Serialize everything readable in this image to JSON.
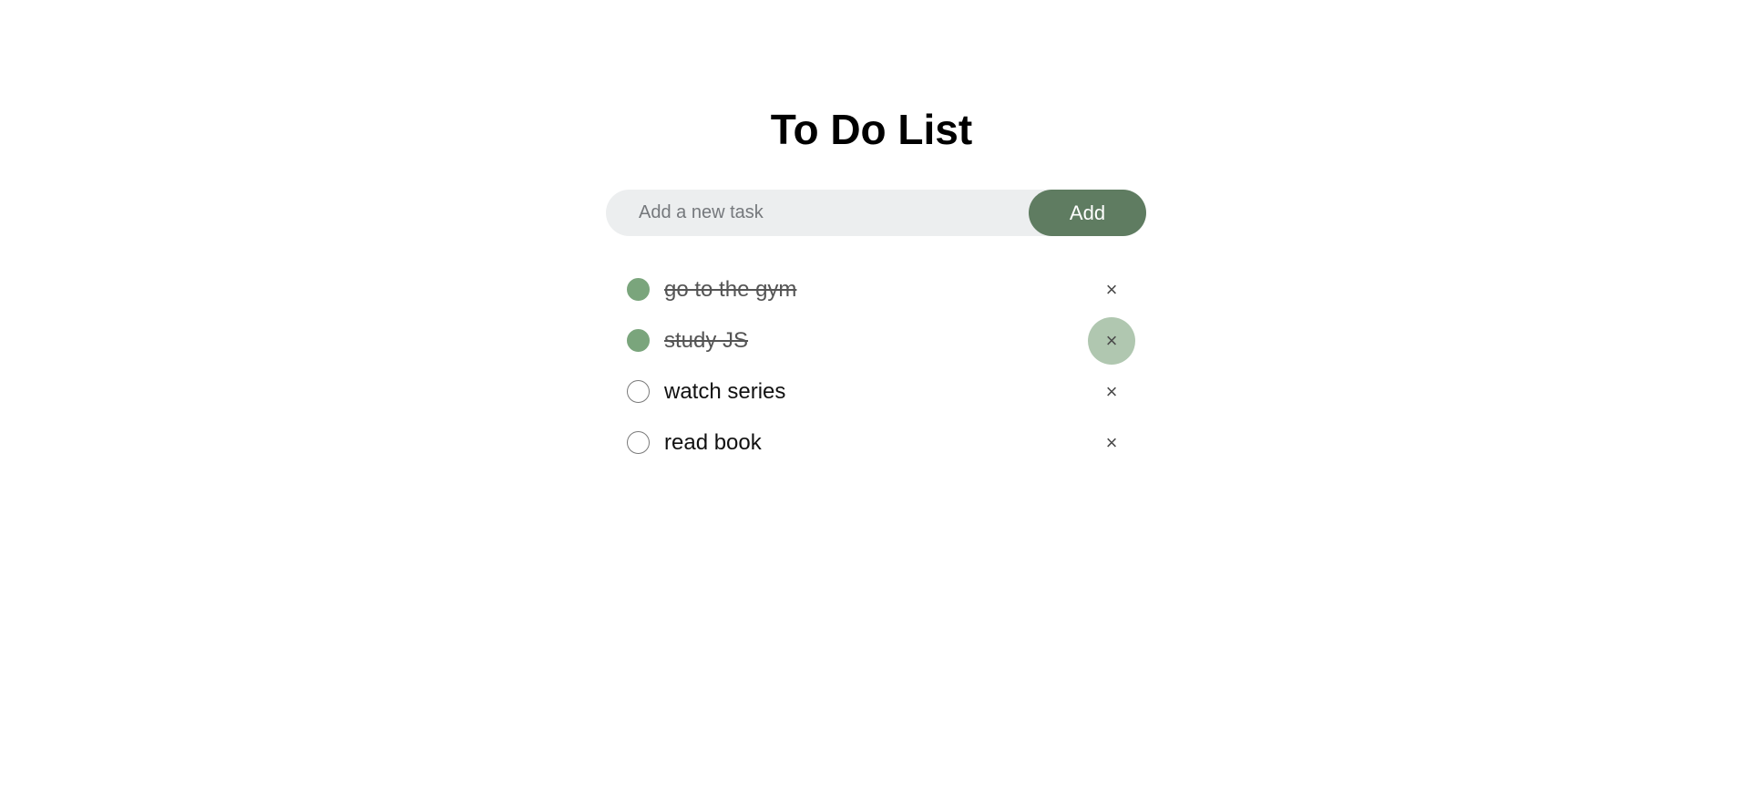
{
  "title": "To Do List",
  "input": {
    "value": "",
    "placeholder": "Add a new task"
  },
  "add_button_label": "Add",
  "tasks": [
    {
      "text": "go to the gym",
      "completed": true,
      "remove_icon": "×"
    },
    {
      "text": "study JS",
      "completed": true,
      "remove_icon": "×"
    },
    {
      "text": "watch series",
      "completed": false,
      "remove_icon": "×"
    },
    {
      "text": "read book",
      "completed": false,
      "remove_icon": "×"
    }
  ],
  "colors": {
    "accent": "#5f7c61",
    "checked": "#7aa57c",
    "input_background": "#eceeef",
    "remove_hover": "#b0c7b0"
  }
}
